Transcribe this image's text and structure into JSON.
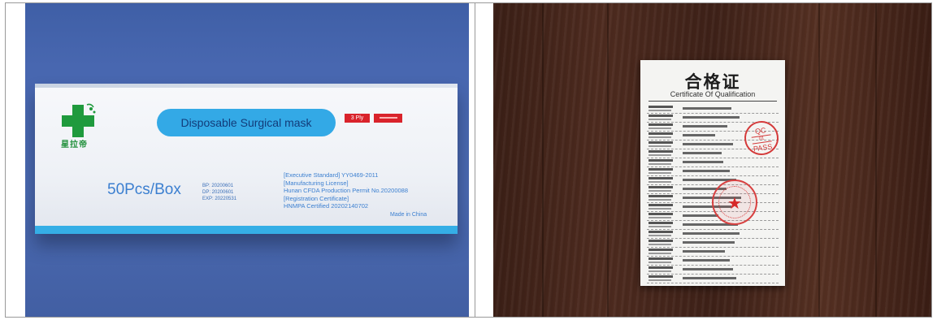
{
  "left_photo": {
    "box_title": "Disposable Surgical mask",
    "ply_badge": "3 Ply",
    "brand_cn": "星拉帝",
    "quantity": "50Pcs/Box",
    "dates": [
      "BP: 20200601",
      "DP: 20200601",
      "EXP: 20220531"
    ],
    "standards": [
      "[Executive Standard] YY0469-2011",
      "[Manufacturing License]",
      "Hunan CFDA Production Permit No.20200088",
      "[Registration Certificate]",
      "HNMPA Certified 20202140702"
    ],
    "made_in": "Made in China",
    "colors": {
      "background": "#4867b0",
      "accent_blue": "#33a9e6",
      "logo_green": "#1f8f3a",
      "badge_red": "#d9232b"
    }
  },
  "right_photo": {
    "cert_title_cn": "合格证",
    "cert_title_en": "Certificate Of Qualification",
    "qc_stamp": {
      "top": "QC",
      "middle": "01",
      "bottom": "PASS"
    },
    "colors": {
      "wood": "#4e2b1f",
      "paper": "#f4f4f2",
      "stamp_red": "#d43a3a"
    }
  }
}
